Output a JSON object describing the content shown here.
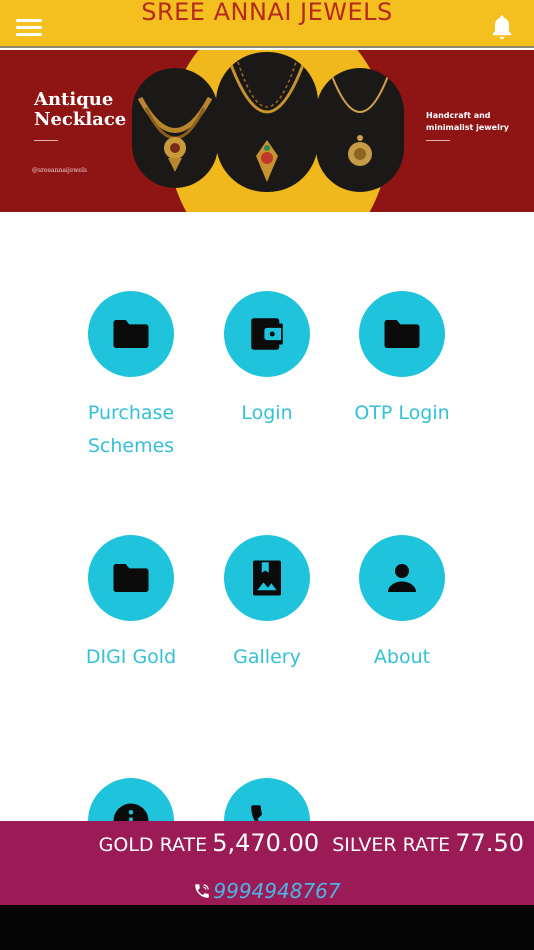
{
  "header": {
    "title": "SREE ANNAI JEWELS",
    "menu_icon": "hamburger-menu-icon",
    "notification_icon": "bell-icon"
  },
  "banner": {
    "title_line1": "Antique",
    "title_line2": "Necklace",
    "handle": "@sreeannaijewels",
    "tagline_line1": "Handcraft and",
    "tagline_line2": "minimalist jewelry"
  },
  "menu": {
    "items": [
      {
        "label_line1": "Purchase",
        "label_line2": "Schemes",
        "icon": "folder-icon"
      },
      {
        "label_line1": "Login",
        "label_line2": "",
        "icon": "wallet-icon"
      },
      {
        "label_line1": "OTP Login",
        "label_line2": "",
        "icon": "folder-icon"
      },
      {
        "label_line1": "DIGI Gold",
        "label_line2": "",
        "icon": "folder-icon"
      },
      {
        "label_line1": "Gallery",
        "label_line2": "",
        "icon": "photo-album-icon"
      },
      {
        "label_line1": "About",
        "label_line2": "",
        "icon": "person-icon"
      },
      {
        "label_line1": "",
        "label_line2": "",
        "icon": "info-icon"
      },
      {
        "label_line1": "",
        "label_line2": "",
        "icon": "phone-icon"
      }
    ]
  },
  "rates": {
    "gold_label": "GOLD RATE",
    "gold_value": "5,470.00",
    "silver_label": "SILVER RATE",
    "silver_value": "77.50"
  },
  "contact": {
    "phone": "9994948767",
    "icon": "phone-call-icon"
  },
  "colors": {
    "header_bg": "#f4c020",
    "title": "#b5291f",
    "banner_bg": "#8f1414",
    "accent": "#1fc3db",
    "rate_bar": "#9b1b57",
    "phone_link": "#4ab6e6"
  }
}
